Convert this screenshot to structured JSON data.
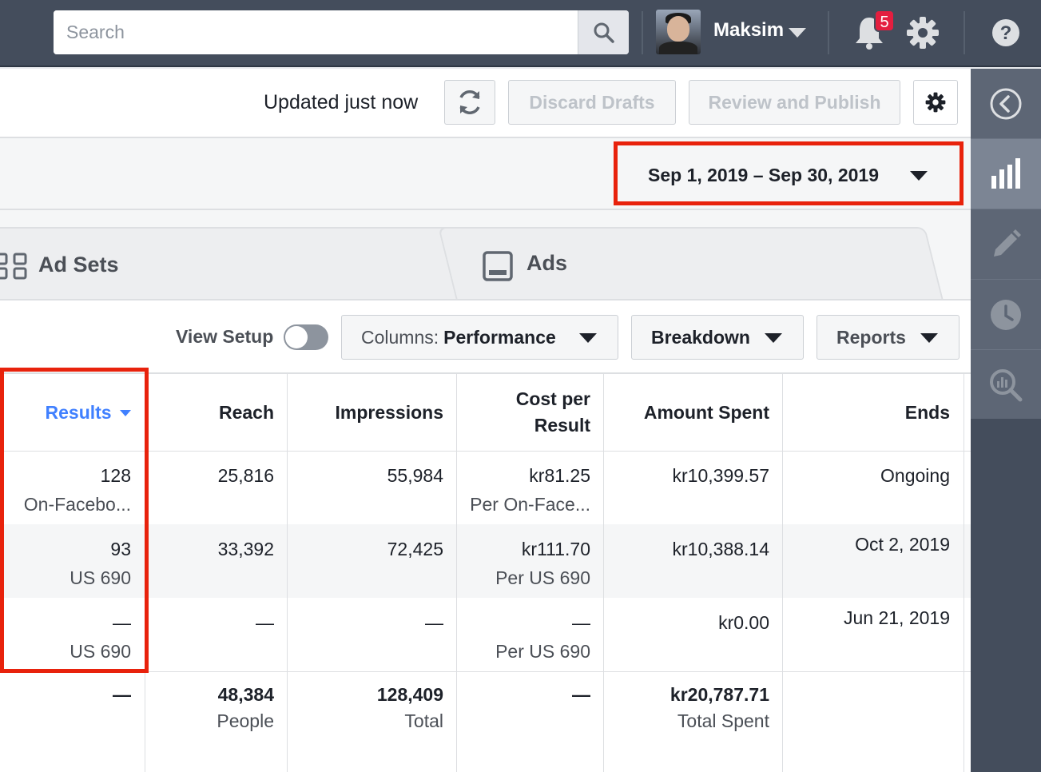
{
  "topbar": {
    "search_placeholder": "Search",
    "user_name": "Maksim",
    "notification_count": "5"
  },
  "toolbar": {
    "updated_text": "Updated just now",
    "discard_label": "Discard Drafts",
    "review_label": "Review and Publish"
  },
  "date_range": {
    "label": "Sep 1, 2019 – Sep 30, 2019"
  },
  "tabs": {
    "ad_sets": "Ad Sets",
    "ads": "Ads"
  },
  "controls": {
    "view_setup": "View Setup",
    "view_setup_on": false,
    "columns_prefix": "Columns:",
    "columns_value": "Performance",
    "breakdown": "Breakdown",
    "reports": "Reports"
  },
  "table": {
    "headers": {
      "results": "Results",
      "reach": "Reach",
      "impressions": "Impressions",
      "cost_line1": "Cost per",
      "cost_line2": "Result",
      "amount": "Amount Spent",
      "ends": "Ends"
    },
    "rows": [
      {
        "results": "128",
        "results_sub": "On-Facebo...",
        "reach": "25,816",
        "impressions": "55,984",
        "cost": "kr81.25",
        "cost_sub": "Per On-Face...",
        "amount": "kr10,399.57",
        "ends": "Ongoing"
      },
      {
        "results": "93",
        "results_sub": "US 690",
        "reach": "33,392",
        "impressions": "72,425",
        "cost": "kr111.70",
        "cost_sub": "Per US 690",
        "amount": "kr10,388.14",
        "ends": "Oct 2, 2019"
      },
      {
        "results": "—",
        "results_sub": "US 690",
        "reach": "—",
        "impressions": "—",
        "cost": "—",
        "cost_sub": "Per US 690",
        "amount": "kr0.00",
        "ends": "Jun 21, 2019"
      }
    ],
    "totals": {
      "results": "—",
      "reach": "48,384",
      "reach_sub": "People",
      "impressions": "128,409",
      "impressions_sub": "Total",
      "cost": "—",
      "amount": "kr20,787.71",
      "amount_sub": "Total Spent"
    }
  },
  "colors": {
    "topbar": "#444d5c",
    "accent_blue": "#4080ff",
    "highlight_red": "#e8220c",
    "badge_red": "#e41e3f"
  },
  "icons": [
    "search-icon",
    "chevron-down-icon",
    "bell-icon",
    "gear-icon",
    "help-icon",
    "refresh-icon",
    "ad-sets-icon",
    "ads-icon",
    "collapse-left-icon",
    "bar-chart-icon",
    "pencil-icon",
    "clock-icon",
    "search-chart-icon"
  ]
}
